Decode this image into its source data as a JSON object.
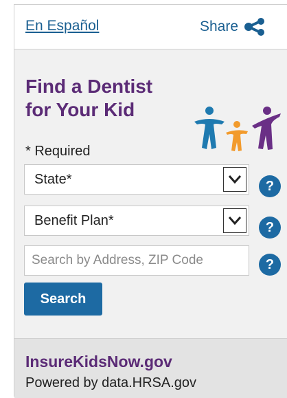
{
  "header": {
    "language_link": "En Español",
    "share_label": "Share",
    "share_icon": "share-icon"
  },
  "form": {
    "title_line1": "Find a Dentist",
    "title_line2": "for Your Kid",
    "illustration": "family-icon",
    "required_note": "* Required",
    "state_select": {
      "value": "State*"
    },
    "plan_select": {
      "value": "Benefit Plan*"
    },
    "address_input": {
      "value": "",
      "placeholder": "Search by Address, ZIP Code"
    },
    "help_label": "?",
    "search_button": "Search"
  },
  "footer": {
    "brand": "InsureKidsNow.gov",
    "powered_by": "Powered by data.HRSA.gov"
  },
  "colors": {
    "link": "#1a5f91",
    "title": "#5b2b76",
    "button": "#1d6aa3",
    "panel": "#f1f1f1",
    "footer": "#e3e3e3"
  }
}
